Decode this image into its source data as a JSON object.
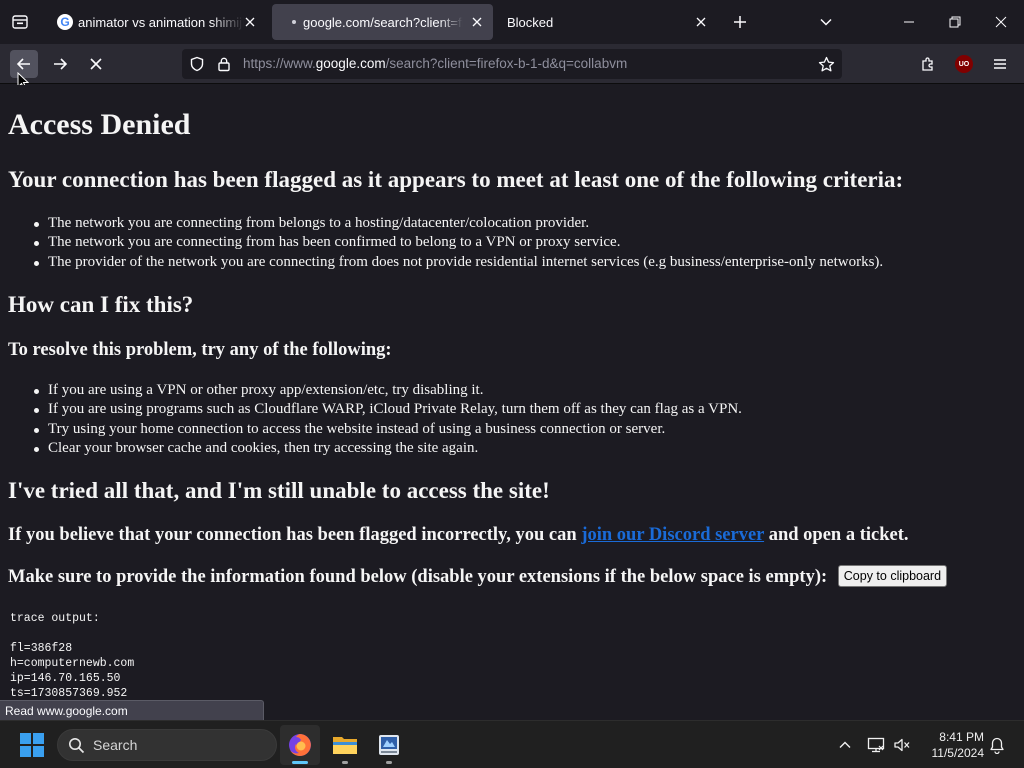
{
  "browser": {
    "tabs": [
      {
        "title": "animator vs animation shimiji - Go"
      },
      {
        "title": "google.com/search?client=firefox"
      },
      {
        "title": "Blocked"
      }
    ],
    "url": {
      "prefix": "https://www.",
      "host": "google.com",
      "rest": "/search?client=firefox-b-1-d&q=collabvm"
    },
    "ublock_badge": "UO",
    "status_text": "Read www.google.com"
  },
  "page": {
    "title": "Access Denied",
    "flagged_heading": "Your connection has been flagged as it appears to meet at least one of the following criteria:",
    "criteria": [
      "The network you are connecting from belongs to a hosting/datacenter/colocation provider.",
      "The network you are connecting from has been confirmed to belong to a VPN or proxy service.",
      "The provider of the network you are connecting from does not provide residential internet services (e.g business/enterprise-only networks)."
    ],
    "fix_heading": "How can I fix this?",
    "resolve_heading": "To resolve this problem, try any of the following:",
    "fixes": [
      "If you are using a VPN or other proxy app/extension/etc, try disabling it.",
      "If you are using programs such as Cloudflare WARP, iCloud Private Relay, turn them off as they can flag as a VPN.",
      "Try using your home connection to access the website instead of using a business connection or server.",
      "Clear your browser cache and cookies, then try accessing the site again."
    ],
    "tried_heading": "I've tried all that, and I'm still unable to access the site!",
    "discord_before": "If you believe that your connection has been flagged incorrectly, you can",
    "discord_link": "join our Discord server",
    "discord_after": "and open a ticket.",
    "provide_text": "Make sure to provide the information found below (disable your extensions if the below space is empty):",
    "copy_button": "Copy to clipboard",
    "trace_label": "trace output:",
    "trace_lines": [
      "fl=386f28",
      "h=computernewb.com",
      "ip=146.70.165.50",
      "ts=1730857369.952"
    ]
  },
  "taskbar": {
    "search_label": "Search",
    "time": "8:41 PM",
    "date": "11/5/2024"
  },
  "colors": {
    "accent_link": "#1a6bd8",
    "windows_blue": "#3aa0f0",
    "firefox_indicator": "#5ec7f9"
  }
}
